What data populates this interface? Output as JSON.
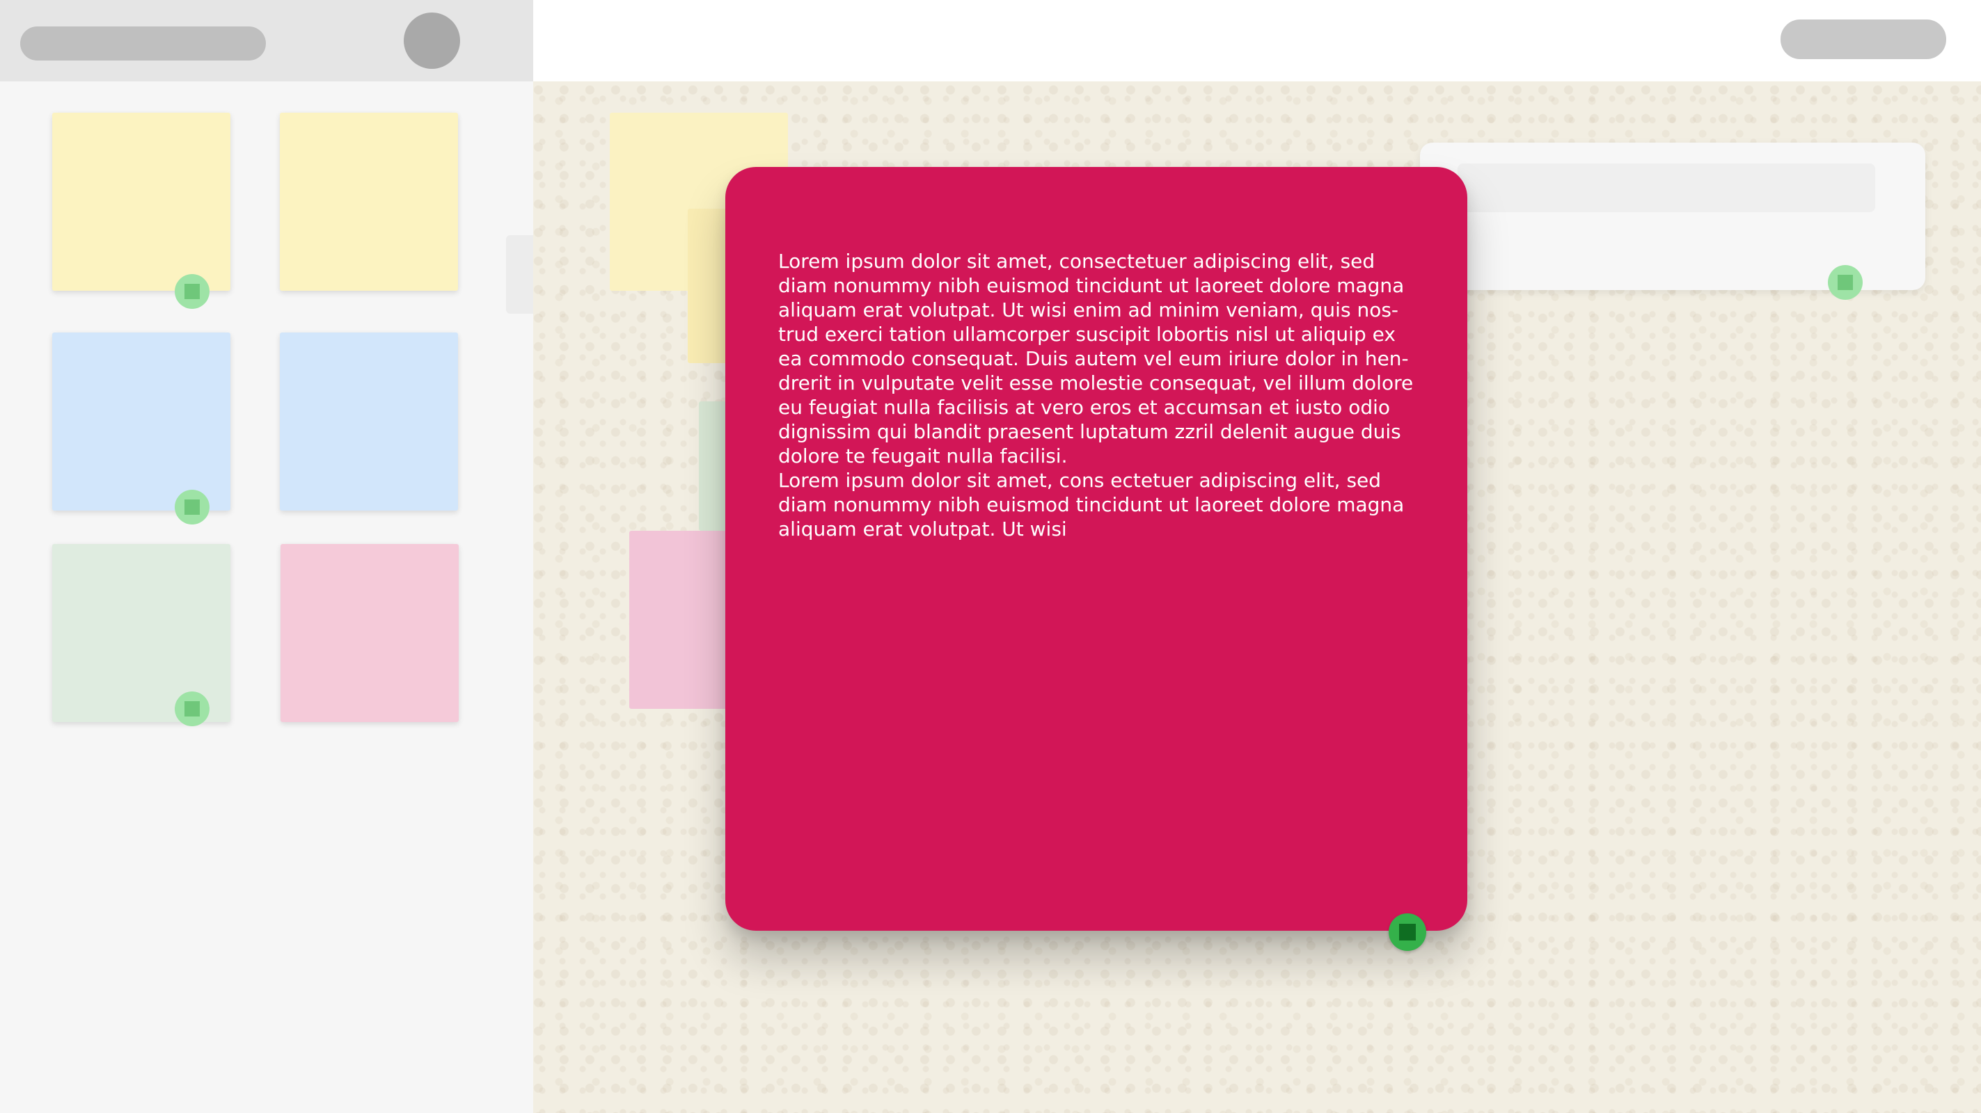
{
  "colors": {
    "focused_note": "#d21657",
    "note_yellow": "#fcf3c1",
    "note_blue": "#d2e6fb",
    "note_green": "#dfece0",
    "note_pink": "#f5cad9",
    "pin": "#34b14a"
  },
  "sidebar": {
    "palette": [
      {
        "color": "yellow",
        "pinned": true
      },
      {
        "color": "yellow",
        "pinned": false
      },
      {
        "color": "blue",
        "pinned": true
      },
      {
        "color": "blue",
        "pinned": false
      },
      {
        "color": "green",
        "pinned": true
      },
      {
        "color": "pink",
        "pinned": false
      }
    ]
  },
  "focused_note": {
    "text": "Lorem ipsum dolor sit amet, consectetuer adipiscing elit, sed\ndiam nonummy nibh euismod tincidunt ut laoreet dolore magna\naliquam erat volutpat. Ut wisi enim ad minim veniam, quis nos-\ntrud exerci tation ullamcorper suscipit lobortis nisl ut aliquip ex\nea commodo consequat. Duis autem vel eum iriure dolor in hen-\ndrerit in vulputate velit esse molestie consequat, vel illum dolore\neu feugiat nulla facilisis at vero eros et accumsan et iusto odio\ndignissim qui blandit praesent luptatum zzril delenit augue duis\ndolore te feugait nulla facilisi.\nLorem ipsum dolor sit amet, cons ectetuer adipiscing elit, sed\ndiam nonummy nibh euismod tincidunt ut laoreet dolore magna\naliquam erat volutpat. Ut wisi"
  },
  "icons": [
    "pin-icon"
  ]
}
